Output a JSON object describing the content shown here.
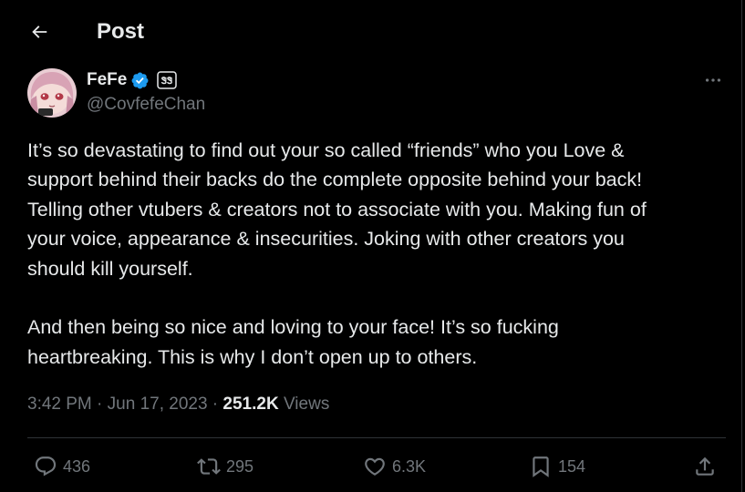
{
  "header": {
    "title": "Post",
    "back_icon": "arrow-left-icon"
  },
  "author": {
    "display_name": "FeFe",
    "handle": "@CovfefeChan",
    "verified": true,
    "verified_color": "#1d9bf0",
    "affiliate_badge_text": "ᏕᏕ"
  },
  "post": {
    "text": "It’s so devastating to find out your so called “friends” who you Love &\nsupport behind their backs do the complete opposite behind your back!\nTelling other vtubers & creators not to associate with you. Making fun of\nyour voice, appearance & insecurities. Joking with other creators you\nshould kill yourself.\n\nAnd then being so nice and loving to your face! It’s so fucking\nheartbreaking. This is why I don’t open up to others.",
    "time": "3:42 PM",
    "sep1": " · ",
    "date": "Jun 17, 2023",
    "sep2": " · ",
    "views_count": "251.2K",
    "views_label": " Views"
  },
  "actions": {
    "replies": "436",
    "reposts": "295",
    "likes": "6.3K",
    "bookmarks": "154"
  },
  "icons": [
    "arrow-left-icon",
    "verified-icon",
    "more-icon",
    "reply-icon",
    "repost-icon",
    "like-icon",
    "bookmark-icon",
    "share-icon"
  ]
}
